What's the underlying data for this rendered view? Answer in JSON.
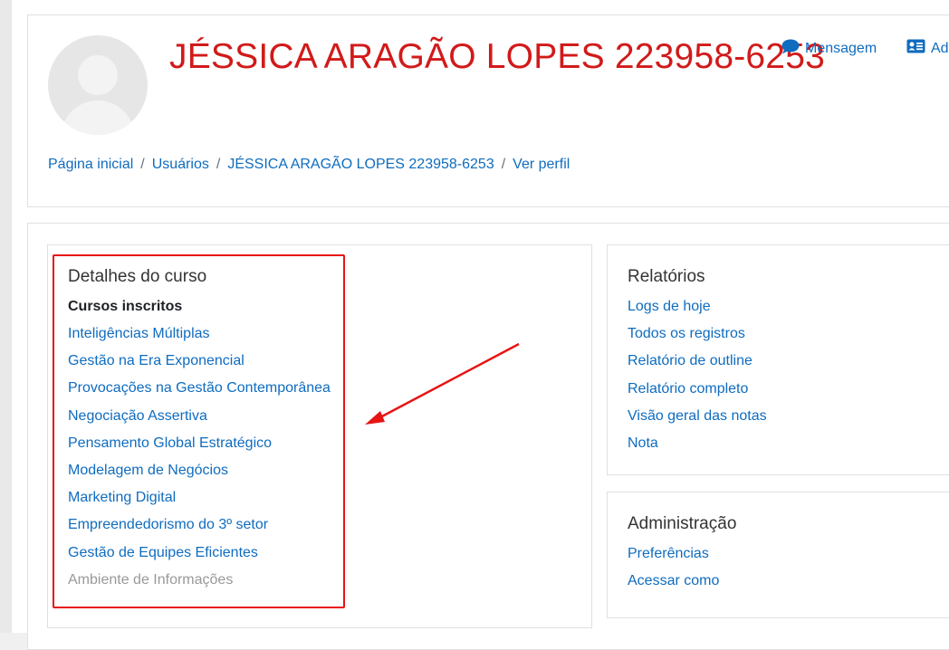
{
  "header": {
    "user_name": "JÉSSICA ARAGÃO LOPES 223958-6253",
    "actions": {
      "message": "Mensagem",
      "add_contact": "Ad"
    }
  },
  "breadcrumb": [
    "Página inicial",
    "Usuários",
    "JÉSSICA ARAGÃO LOPES 223958-6253",
    "Ver perfil"
  ],
  "course_details": {
    "title": "Detalhes do curso",
    "enrolled_heading": "Cursos inscritos",
    "courses": [
      "Inteligências Múltiplas",
      "Gestão na Era Exponencial",
      "Provocações na Gestão Contemporânea",
      "Negociação Assertiva",
      "Pensamento Global Estratégico",
      "Modelagem de Negócios",
      "Marketing Digital",
      "Empreendedorismo do 3º setor",
      "Gestão de Equipes Eficientes",
      "Ambiente de Informações"
    ]
  },
  "reports": {
    "title": "Relatórios",
    "items": [
      "Logs de hoje",
      "Todos os registros",
      "Relatório de outline",
      "Relatório completo",
      "Visão geral das notas",
      "Nota"
    ]
  },
  "administration": {
    "title": "Administração",
    "items": [
      "Preferências",
      "Acessar como"
    ]
  },
  "colors": {
    "link": "#0f6cbf",
    "name": "#d11a1a",
    "annotation": "#e81313",
    "dimmed": "#999999"
  },
  "icons": {
    "message": "speech-bubble-icon",
    "add_contact": "address-card-icon"
  }
}
